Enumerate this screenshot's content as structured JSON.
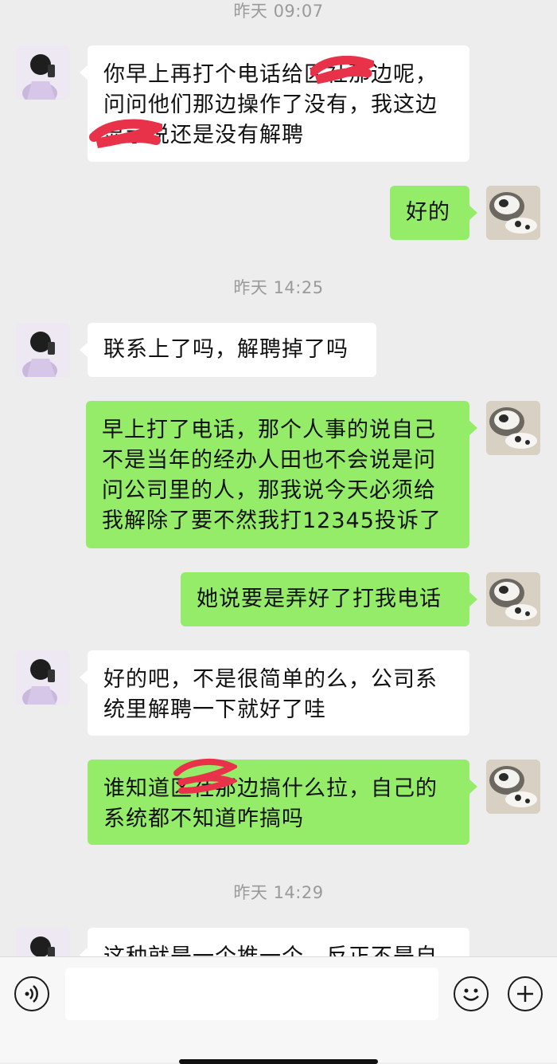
{
  "timestamps": [
    "昨天 09:07",
    "昨天 14:25",
    "昨天 14:29"
  ],
  "messages": [
    {
      "side": "in",
      "lines": [
        "你早上再打个电话给区社那边呢，",
        "问问他们那边操作了没有，我这边",
        "显示说还是没有解聘"
      ]
    },
    {
      "side": "out",
      "lines": [
        "好的"
      ]
    },
    {
      "side": "in",
      "lines": [
        "联系上了吗，解聘掉了吗"
      ]
    },
    {
      "side": "out",
      "lines": [
        "早上打了电话，那个人事的说自己",
        "不是当年的经办人田也不会说是问",
        "问公司里的人，那我说今天必须给",
        "我解除了要不然我打12345投诉了"
      ]
    },
    {
      "side": "out",
      "lines": [
        "她说要是弄好了打我电话"
      ]
    },
    {
      "side": "in",
      "lines": [
        "好的吧，不是很简单的么，公司系",
        "统里解聘一下就好了哇"
      ]
    },
    {
      "side": "out",
      "lines": [
        "谁知道区社那边搞什么拉，自己的",
        "系统都不知道咋搞吗"
      ]
    },
    {
      "side": "in",
      "lines": [
        "这种就是一个推一个，反正不是自"
      ]
    }
  ],
  "input": {
    "value": "",
    "placeholder": ""
  },
  "icons": {
    "voice": "voice-toggle-icon",
    "emoji": "emoji-icon",
    "more": "plus-icon",
    "avatar_contact": "contact-avatar-icon",
    "avatar_self": "self-avatar-icon"
  },
  "colors": {
    "background": "#ededed",
    "bubble_in": "#ffffff",
    "bubble_out": "#95ec69",
    "redaction": "#e8324a"
  }
}
